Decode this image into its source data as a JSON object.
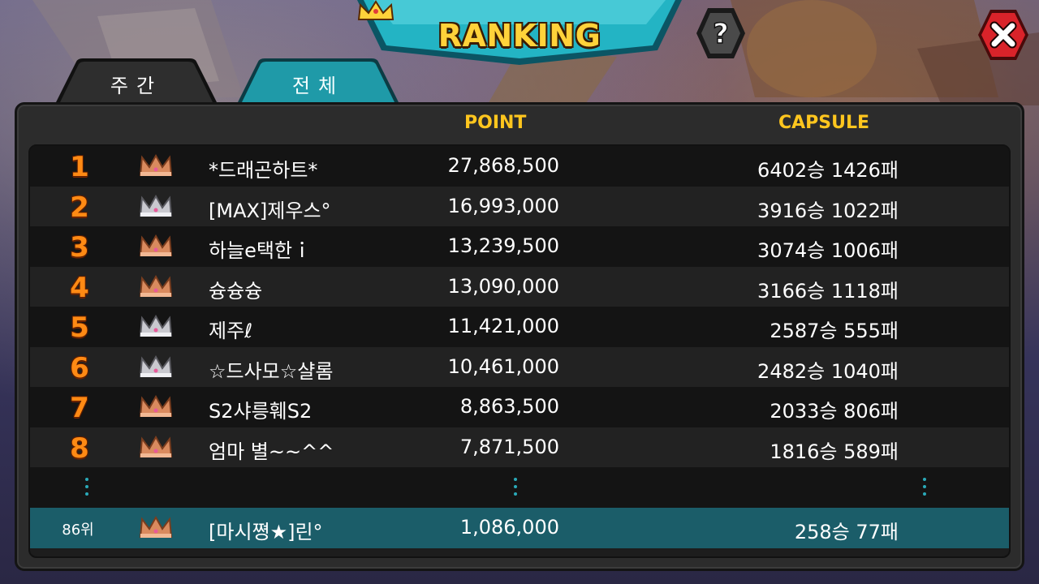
{
  "title": "RANKING",
  "buttons": {
    "help_icon": "question-mark",
    "close_icon": "x-mark"
  },
  "tabs": [
    {
      "label": "주간",
      "active": false
    },
    {
      "label": "전체",
      "active": true
    }
  ],
  "columns": {
    "point": "POINT",
    "capsule": "CAPSULE"
  },
  "rows": [
    {
      "rank": "1",
      "crown": "bronze",
      "name": "*드래곤하트*",
      "points": "27,868,500",
      "record": "6402승 1426패"
    },
    {
      "rank": "2",
      "crown": "silver",
      "name": "[MAX]제우스°",
      "points": "16,993,000",
      "record": "3916승 1022패"
    },
    {
      "rank": "3",
      "crown": "bronze",
      "name": "하늘e택한ｉ",
      "points": "13,239,500",
      "record": "3074승 1006패"
    },
    {
      "rank": "4",
      "crown": "bronze",
      "name": "슝슝슝",
      "points": "13,090,000",
      "record": "3166승 1118패"
    },
    {
      "rank": "5",
      "crown": "silver",
      "name": "제주ℓ",
      "points": "11,421,000",
      "record": "2587승 555패"
    },
    {
      "rank": "6",
      "crown": "silver",
      "name": "☆드사모☆샬롬",
      "points": "10,461,000",
      "record": "2482승 1040패"
    },
    {
      "rank": "7",
      "crown": "bronze",
      "name": "S2샤릉훼S2",
      "points": "8,863,500",
      "record": "2033승 806패"
    },
    {
      "rank": "8",
      "crown": "bronze",
      "name": "엄마 별~~^^",
      "points": "7,871,500",
      "record": "1816승 589패"
    }
  ],
  "my_rank": {
    "rank": "86위",
    "crown": "bronze",
    "name": "[마시쪙★]린°",
    "points": "1,086,000",
    "record": "258승 77패"
  },
  "colors": {
    "accent": "#ffc61e",
    "rank_number": "#ff8a14",
    "tab_active": "#1f9aa8",
    "tab_inactive": "#2e2e2e",
    "highlight_row": "#1b5d69",
    "close_red": "#d9232a"
  }
}
